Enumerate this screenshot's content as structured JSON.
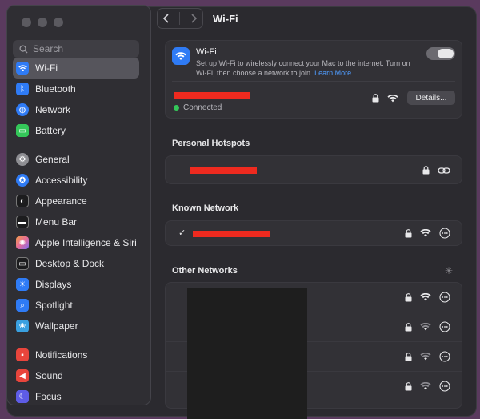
{
  "search": {
    "placeholder": "Search"
  },
  "sidebar": {
    "items": [
      {
        "label": "Wi-Fi",
        "icon": "wifi-icon",
        "color": "#2f7bf5"
      },
      {
        "label": "Bluetooth",
        "icon": "bluetooth-icon",
        "color": "#2f7bf5"
      },
      {
        "label": "Network",
        "icon": "globe-icon",
        "color": "#2f7bf5"
      },
      {
        "label": "Battery",
        "icon": "battery-icon",
        "color": "#34c759"
      },
      {
        "label": "General",
        "icon": "gear-icon",
        "color": "#8e8e93"
      },
      {
        "label": "Accessibility",
        "icon": "accessibility-icon",
        "color": "#2f7bf5"
      },
      {
        "label": "Appearance",
        "icon": "appearance-icon",
        "color": "#1c1c1e"
      },
      {
        "label": "Menu Bar",
        "icon": "menubar-icon",
        "color": "#1c1c1e"
      },
      {
        "label": "Apple Intelligence & Siri",
        "icon": "siri-icon",
        "color": "#e56b9a"
      },
      {
        "label": "Desktop & Dock",
        "icon": "dock-icon",
        "color": "#1c1c1e"
      },
      {
        "label": "Displays",
        "icon": "sun-icon",
        "color": "#2f7bf5"
      },
      {
        "label": "Spotlight",
        "icon": "magnifier-icon",
        "color": "#2f7bf5"
      },
      {
        "label": "Wallpaper",
        "icon": "flower-icon",
        "color": "#3aa0e0"
      },
      {
        "label": "Notifications",
        "icon": "bell-icon",
        "color": "#e8453c"
      },
      {
        "label": "Sound",
        "icon": "speaker-icon",
        "color": "#e8453c"
      },
      {
        "label": "Focus",
        "icon": "moon-icon",
        "color": "#5e5ce6"
      }
    ]
  },
  "header": {
    "title": "Wi-Fi"
  },
  "wifi": {
    "title": "Wi-Fi",
    "desc": "Set up Wi-Fi to wirelessly connect your Mac to the internet. Turn on Wi-Fi, then choose a network to join.",
    "learn_more": "Learn More...",
    "status": "Connected",
    "details_label": "Details..."
  },
  "sections": {
    "hotspots": "Personal Hotspots",
    "known": "Known Network",
    "other": "Other Networks"
  },
  "colors": {
    "accent": "#2f7bf5",
    "connected": "#34c759",
    "redaction": "#ee2a1f"
  }
}
